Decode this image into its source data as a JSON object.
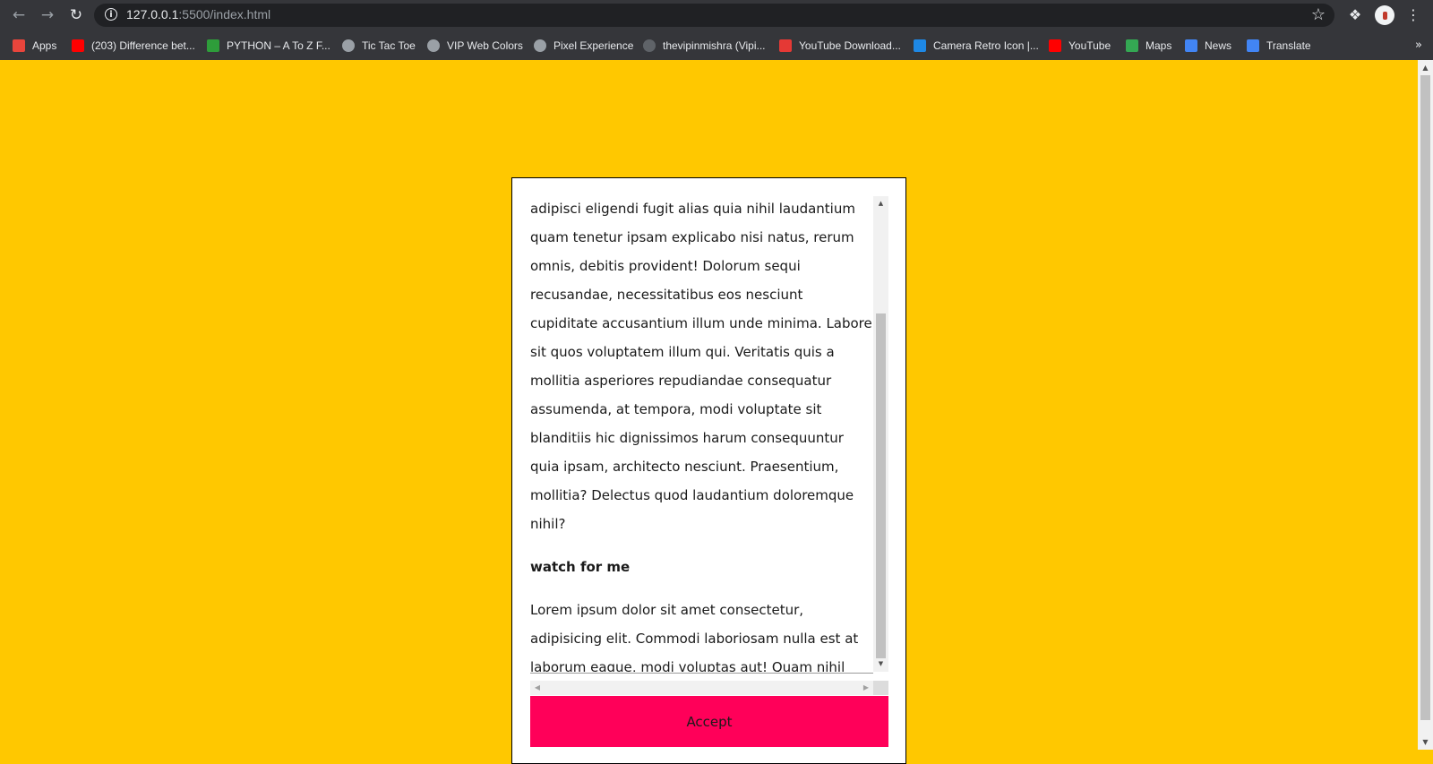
{
  "browser": {
    "url_host": "127.0.0.1",
    "url_rest": ":5500/index.html",
    "bookmarks": [
      {
        "label": "Apps",
        "icon": "apps-grid-icon",
        "color": "#e8453c"
      },
      {
        "label": "(203) Difference bet...",
        "icon": "youtube-icon",
        "color": "#ff0000"
      },
      {
        "label": "PYTHON – A To Z F...",
        "icon": "ftu-icon",
        "color": "#2e9d3a"
      },
      {
        "label": "Tic Tac Toe",
        "icon": "globe-icon",
        "color": "#9aa0a6"
      },
      {
        "label": "VIP Web Colors",
        "icon": "globe-icon",
        "color": "#9aa0a6"
      },
      {
        "label": "Pixel Experience",
        "icon": "globe-icon",
        "color": "#9aa0a6"
      },
      {
        "label": "thevipinmishra (Vipi...",
        "icon": "github-icon",
        "color": "#1f1f1f"
      },
      {
        "label": "YouTube Download...",
        "icon": "download-icon",
        "color": "#e53935"
      },
      {
        "label": "Camera Retro Icon |...",
        "icon": "flag-icon",
        "color": "#1e88e5"
      },
      {
        "label": "YouTube",
        "icon": "youtube-icon",
        "color": "#ff0000"
      },
      {
        "label": "Maps",
        "icon": "maps-icon",
        "color": "#34a853"
      },
      {
        "label": "News",
        "icon": "news-icon",
        "color": "#4285f4"
      },
      {
        "label": "Translate",
        "icon": "translate-icon",
        "color": "#4285f4"
      }
    ]
  },
  "card": {
    "paragraph1": "adipisci eligendi fugit alias quia nihil laudantium quam tenetur ipsam explicabo nisi natus, rerum omnis, debitis provident! Dolorum sequi recusandae, necessitatibus eos nesciunt cupiditate accusantium illum unde minima. Labore sit quos voluptatem illum qui. Veritatis quis a mollitia asperiores repudiandae consequatur assumenda, at tempora, modi voluptate sit blanditiis hic dignissimos harum consequuntur quia ipsam, architecto nesciunt. Praesentium, mollitia? Delectus quod laudantium doloremque nihil?",
    "heading": "watch for me",
    "paragraph2": "Lorem ipsum dolor sit amet consectetur, adipisicing elit. Commodi laboriosam nulla est at laborum eaque, modi voluptas aut! Quam nihil deleniti velit excepturi, quidem, veniam aut",
    "button_label": "Accept"
  },
  "colors": {
    "page_background": "#ffc800",
    "button": "#ff0059"
  }
}
